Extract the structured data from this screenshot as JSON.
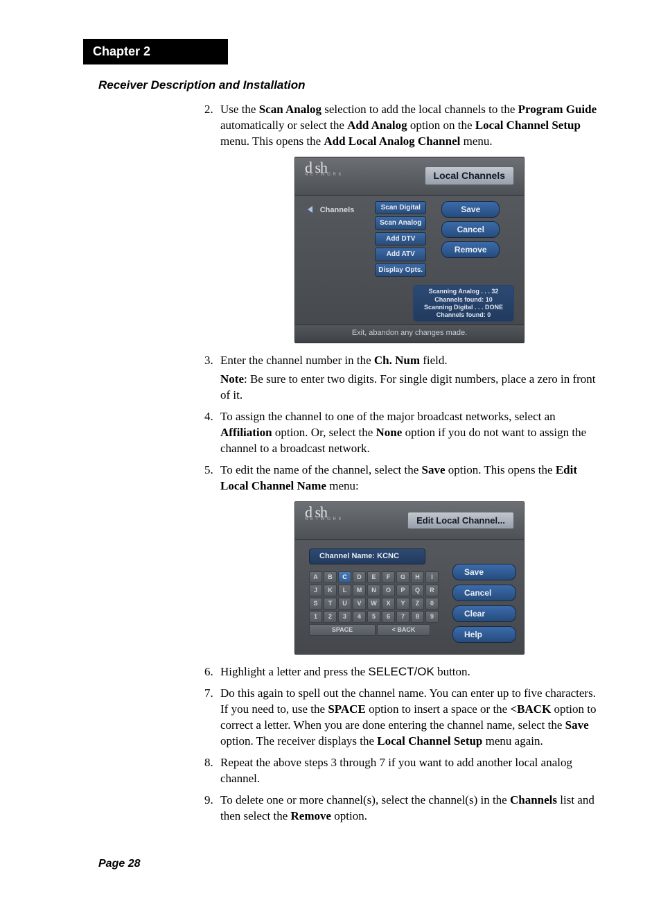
{
  "chapter": "Chapter 2",
  "section_title": "Receiver Description and Installation",
  "page_label": "Page 28",
  "steps": {
    "s2": {
      "pre": "Use the ",
      "b1": "Scan Analog",
      "mid1": " selection to add the local channels to the ",
      "b2": "Program Guide",
      "mid2": " automatically or select the ",
      "b3": "Add Analog",
      "mid3": " option on the ",
      "b4": "Local Channel Setup",
      "mid4": " menu. This opens the ",
      "b5": "Add Local Analog Channel",
      "post": " menu."
    },
    "s3": {
      "pre": "Enter the channel number in the ",
      "b1": "Ch. Num",
      "post": " field.",
      "note_b": "Note",
      "note_rest": ": Be sure to enter two digits. For single digit numbers, place a zero in front of it."
    },
    "s4": {
      "pre": "To assign the channel to one of the major broadcast networks, select an ",
      "b1": "Affiliation",
      "mid1": " option. Or, select the ",
      "b2": "None",
      "post": " option if you do not want to assign the channel to a broadcast network."
    },
    "s5": {
      "pre": "To edit the name of the channel, select the ",
      "b1": "Save",
      "mid1": " option. This opens the ",
      "b2": "Edit Local Channel Name",
      "post": " menu:"
    },
    "s6": {
      "pre": "Highlight a letter and press the ",
      "btn": "SELECT/OK",
      "post": " button."
    },
    "s7": {
      "pre": "Do this again to spell out the channel name. You can enter up to five characters. If you need to, use the ",
      "b1": "SPACE",
      "mid1": " option to insert a space or the ",
      "b2": "<BACK",
      "mid2": " option to correct a letter. When you are done entering the channel name, select the ",
      "b3": "Save",
      "mid3": " option. The receiver displays the ",
      "b4": "Local Channel Setup",
      "post": " menu again."
    },
    "s8": "Repeat the above steps 3 through 7 if you want to add another local analog channel.",
    "s9": {
      "pre": "To delete one or more channel(s), select the channel(s) in the ",
      "b1": "Channels",
      "mid1": " list and then select the ",
      "b2": "Remove",
      "post": " option."
    }
  },
  "fig1": {
    "logo_main": "d sh",
    "logo_sub": "N E T W O R K",
    "title": "Local Channels",
    "channels_label": "Channels",
    "mid_buttons": [
      "Scan Digital",
      "Scan Analog",
      "Add DTV",
      "Add ATV",
      "Display Opts."
    ],
    "right_buttons": [
      "Save",
      "Cancel",
      "Remove"
    ],
    "status": [
      "Scanning Analog . . . 32",
      "Channels found: 10",
      "Scanning Digital . . . DONE",
      "Channels found: 0"
    ],
    "footer": "Exit, abandon any changes made."
  },
  "fig2": {
    "logo_main": "d sh",
    "logo_sub": "N E T W O R K",
    "title": "Edit Local Channel...",
    "chname": "Channel Name: KCNC",
    "rows": [
      [
        "A",
        "B",
        "C",
        "D",
        "E",
        "F",
        "G",
        "H",
        "I"
      ],
      [
        "J",
        "K",
        "L",
        "M",
        "N",
        "O",
        "P",
        "Q",
        "R"
      ],
      [
        "S",
        "T",
        "U",
        "V",
        "W",
        "X",
        "Y",
        "Z",
        "0"
      ],
      [
        "1",
        "2",
        "3",
        "4",
        "5",
        "6",
        "7",
        "8",
        "9"
      ]
    ],
    "space": "SPACE",
    "back": "< BACK",
    "right_buttons": [
      "Save",
      "Cancel",
      "Clear",
      "Help"
    ]
  }
}
